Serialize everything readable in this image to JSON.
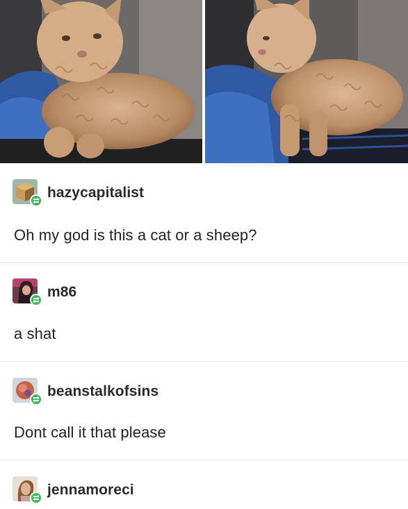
{
  "photos": {
    "left": {
      "subject": "curly-haired kitten on blue blanket"
    },
    "right": {
      "subject": "curly-haired kitten side view"
    }
  },
  "posts": [
    {
      "username": "hazycapitalist",
      "text": "Oh my god is this a cat or a sheep?",
      "avatar_icon": "cube-avatar-icon"
    },
    {
      "username": "m86",
      "text": "a shat",
      "avatar_icon": "portrait-avatar-icon"
    },
    {
      "username": "beanstalkofsins",
      "text": "Dont call it that please",
      "avatar_icon": "orb-avatar-icon"
    },
    {
      "username": "jennamoreci",
      "text": "",
      "avatar_icon": "portrait-avatar-icon"
    }
  ],
  "colors": {
    "reblog_badge": "#3bb75a",
    "divider": "#e6e6e6",
    "text": "#222222"
  }
}
